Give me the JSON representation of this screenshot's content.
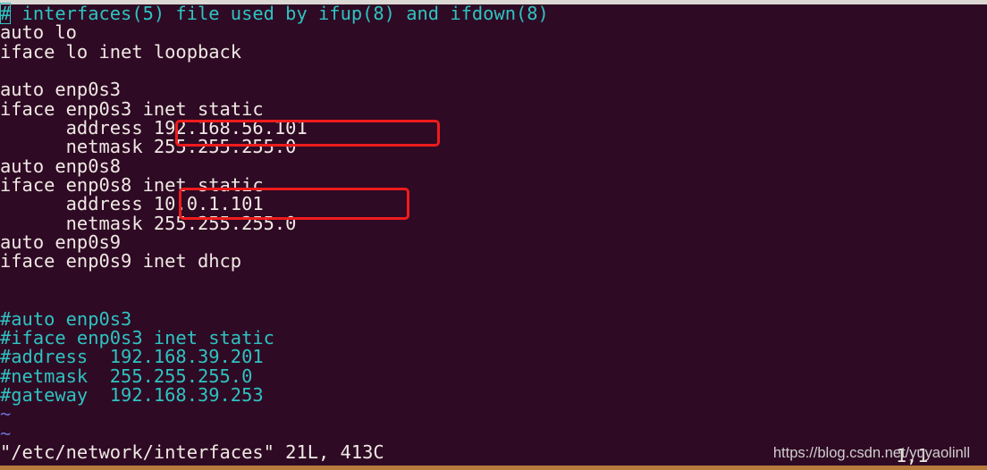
{
  "editor": {
    "lines": [
      {
        "text": "# interfaces(5) file used by ifup(8) and ifdown(8)",
        "style": "comment"
      },
      {
        "text": "auto lo",
        "style": "normal"
      },
      {
        "text": "iface lo inet loopback",
        "style": "normal"
      },
      {
        "text": "",
        "style": "normal"
      },
      {
        "text": "auto enp0s3",
        "style": "normal"
      },
      {
        "text": "iface enp0s3 inet static",
        "style": "normal"
      },
      {
        "text": "      address 192.168.56.101",
        "style": "normal"
      },
      {
        "text": "      netmask 255.255.255.0",
        "style": "normal"
      },
      {
        "text": "auto enp0s8",
        "style": "normal"
      },
      {
        "text": "iface enp0s8 inet static",
        "style": "normal"
      },
      {
        "text": "      address 10.0.1.101",
        "style": "normal"
      },
      {
        "text": "      netmask 255.255.255.0",
        "style": "normal"
      },
      {
        "text": "auto enp0s9",
        "style": "normal"
      },
      {
        "text": "iface enp0s9 inet dhcp",
        "style": "normal"
      },
      {
        "text": "",
        "style": "normal"
      },
      {
        "text": "",
        "style": "normal"
      },
      {
        "text": "#auto enp0s3",
        "style": "comment"
      },
      {
        "text": "#iface enp0s3 inet static",
        "style": "comment"
      },
      {
        "text": "#address  192.168.39.201",
        "style": "comment"
      },
      {
        "text": "#netmask  255.255.255.0",
        "style": "comment"
      },
      {
        "text": "#gateway  192.168.39.253",
        "style": "comment"
      },
      {
        "text": "~",
        "style": "tilde"
      },
      {
        "text": "~",
        "style": "tilde"
      }
    ],
    "status_line": "\"/etc/network/interfaces\" 21L, 413C",
    "cursor_position": "1,1"
  },
  "highlights": [
    {
      "label": "enp0s3 address",
      "value": "192.168.56.101",
      "color": "#ee1c1c"
    },
    {
      "label": "enp0s8 address",
      "value": "10.0.1.101",
      "color": "#ee1c1c"
    }
  ],
  "watermark": "https://blog.csdn.net/yuyaolinll",
  "colors": {
    "background": "#2f0a24",
    "text": "#efe9e4",
    "comment": "#2ec3c1",
    "tilde": "#6c6fd0"
  }
}
